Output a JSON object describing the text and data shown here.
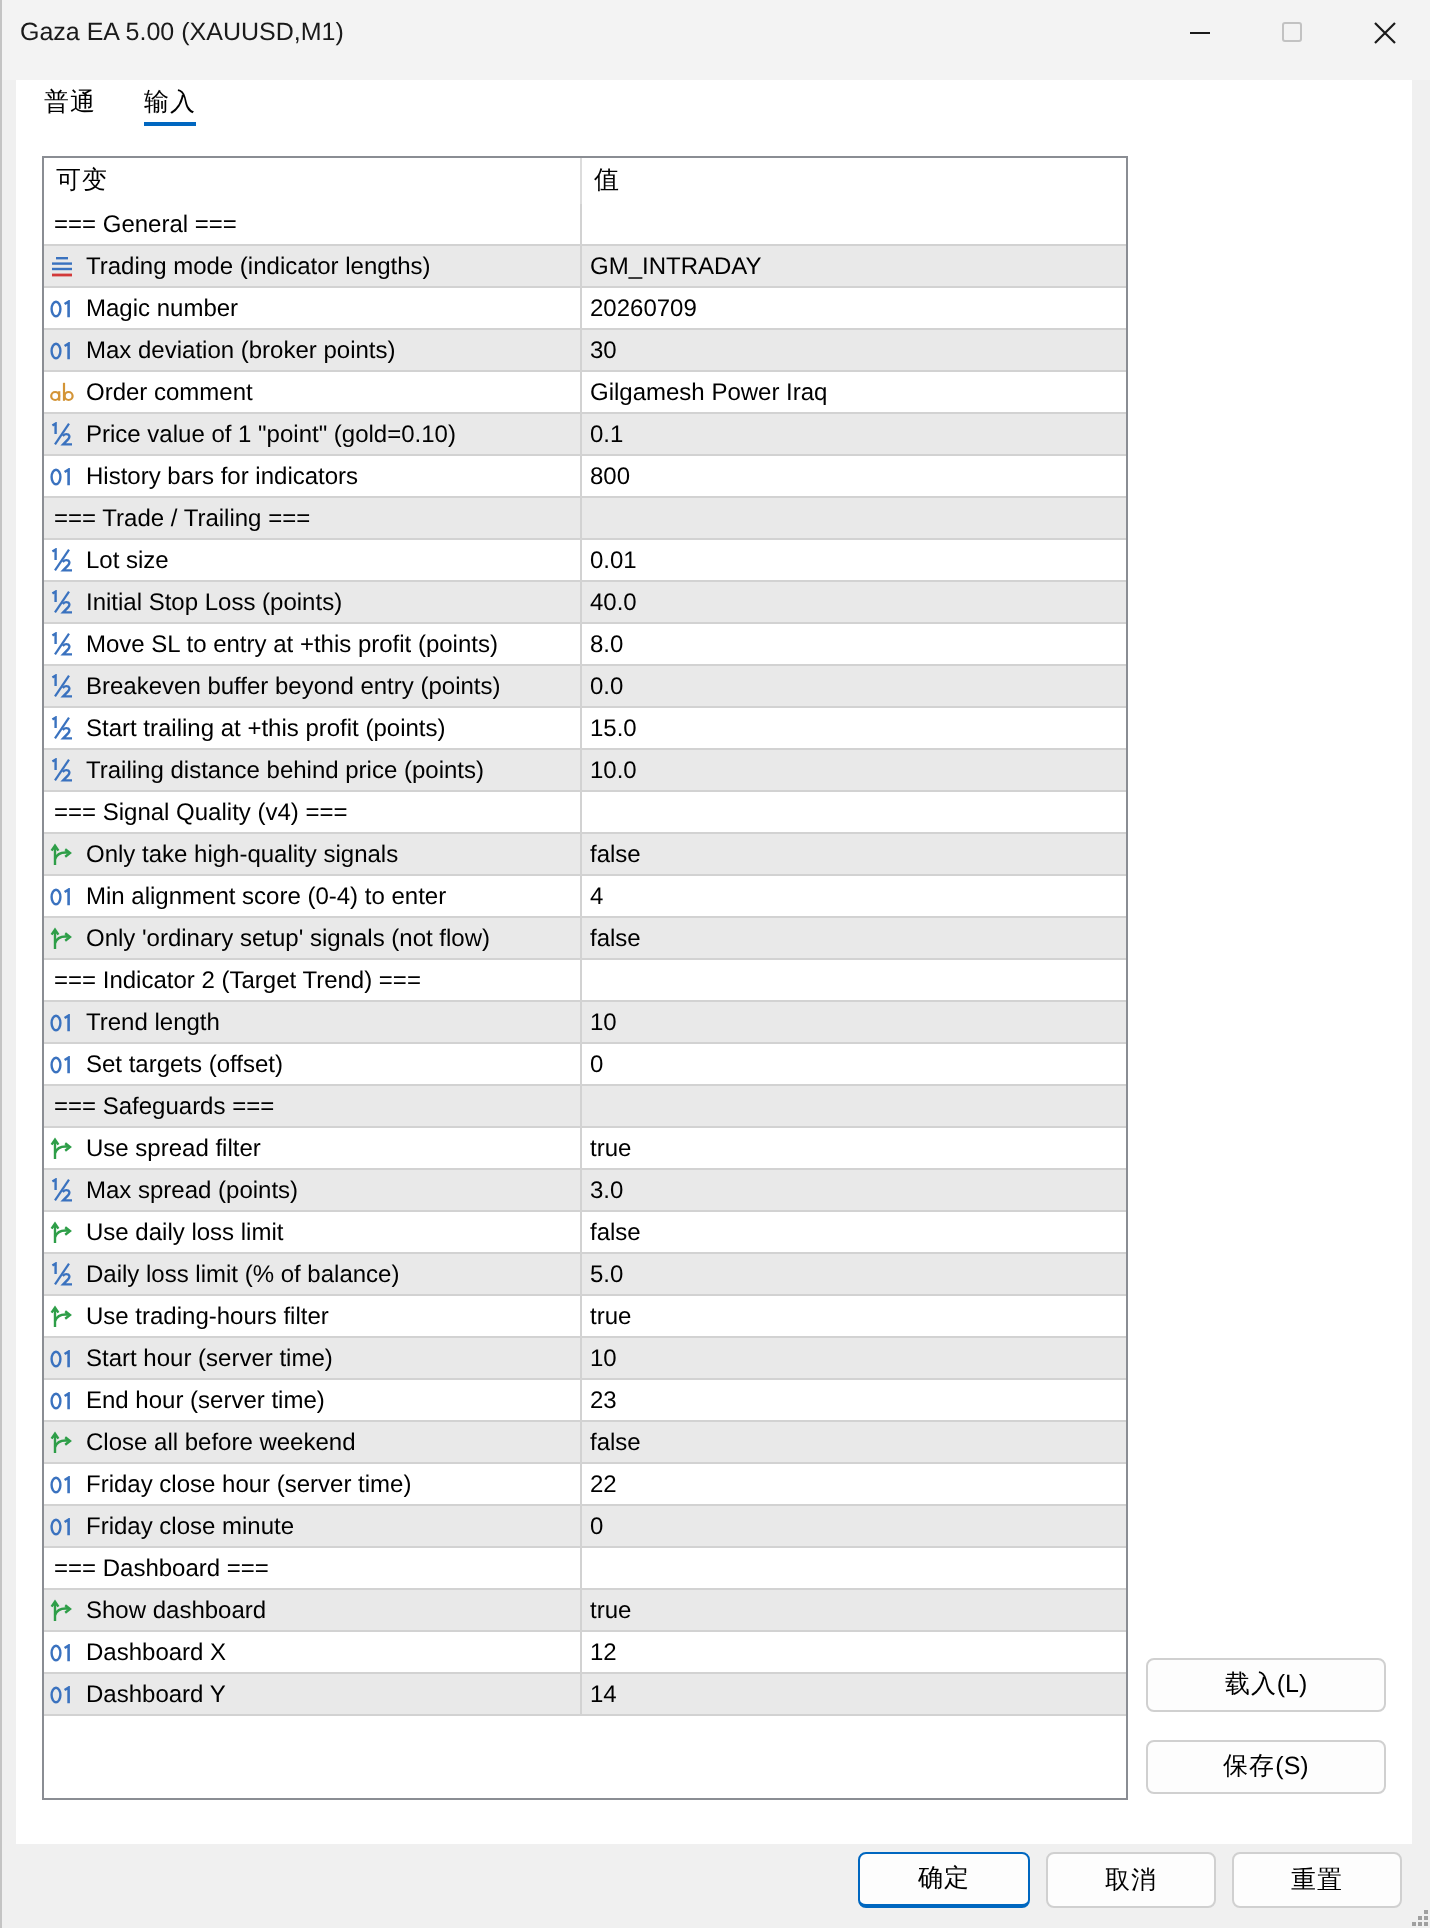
{
  "window": {
    "title": "Gaza EA 5.00 (XAUUSD,M1)",
    "controls": [
      {
        "kind": "minimize",
        "disabled": false
      },
      {
        "kind": "maximize",
        "disabled": true
      },
      {
        "kind": "close",
        "disabled": false
      }
    ]
  },
  "tabs": [
    {
      "label": "普通",
      "selected": false
    },
    {
      "label": "输入",
      "selected": true
    }
  ],
  "table": {
    "columns": [
      "可变",
      "值"
    ],
    "rows": [
      {
        "kind": "section",
        "name": "=== General ==="
      },
      {
        "kind": "enum",
        "name": "Trading mode (indicator lengths)",
        "value": "GM_INTRADAY"
      },
      {
        "kind": "int",
        "name": "Magic number",
        "value": "20260709"
      },
      {
        "kind": "int",
        "name": "Max deviation (broker points)",
        "value": "30"
      },
      {
        "kind": "string",
        "name": "Order comment",
        "value": "Gilgamesh Power Iraq"
      },
      {
        "kind": "double",
        "name": "Price value of 1 \"point\" (gold=0.10)",
        "value": "0.1"
      },
      {
        "kind": "int",
        "name": "History bars for indicators",
        "value": "800"
      },
      {
        "kind": "section",
        "name": "=== Trade / Trailing ==="
      },
      {
        "kind": "double",
        "name": "Lot size",
        "value": "0.01"
      },
      {
        "kind": "double",
        "name": "Initial Stop Loss (points)",
        "value": "40.0"
      },
      {
        "kind": "double",
        "name": "Move SL to entry at +this profit (points)",
        "value": "8.0"
      },
      {
        "kind": "double",
        "name": "Breakeven buffer beyond entry (points)",
        "value": "0.0"
      },
      {
        "kind": "double",
        "name": "Start trailing at +this profit (points)",
        "value": "15.0"
      },
      {
        "kind": "double",
        "name": "Trailing distance behind price (points)",
        "value": "10.0"
      },
      {
        "kind": "section",
        "name": "=== Signal Quality (v4) ==="
      },
      {
        "kind": "bool",
        "name": "Only take high-quality signals",
        "value": "false"
      },
      {
        "kind": "int",
        "name": "Min alignment score (0-4) to enter",
        "value": "4"
      },
      {
        "kind": "bool",
        "name": "Only 'ordinary setup' signals (not flow)",
        "value": "false"
      },
      {
        "kind": "section",
        "name": "=== Indicator 2 (Target Trend) ==="
      },
      {
        "kind": "int",
        "name": "Trend length",
        "value": "10"
      },
      {
        "kind": "int",
        "name": "Set targets (offset)",
        "value": "0"
      },
      {
        "kind": "section",
        "name": "=== Safeguards ==="
      },
      {
        "kind": "bool",
        "name": "Use spread filter",
        "value": "true"
      },
      {
        "kind": "double",
        "name": "Max spread (points)",
        "value": "3.0"
      },
      {
        "kind": "bool",
        "name": "Use daily loss limit",
        "value": "false"
      },
      {
        "kind": "double",
        "name": "Daily loss limit (% of balance)",
        "value": "5.0"
      },
      {
        "kind": "bool",
        "name": "Use trading-hours filter",
        "value": "true"
      },
      {
        "kind": "int",
        "name": "Start hour (server time)",
        "value": "10"
      },
      {
        "kind": "int",
        "name": "End hour (server time)",
        "value": "23"
      },
      {
        "kind": "bool",
        "name": "Close all before weekend",
        "value": "false"
      },
      {
        "kind": "int",
        "name": "Friday close hour (server time)",
        "value": "22"
      },
      {
        "kind": "int",
        "name": "Friday close minute",
        "value": "0"
      },
      {
        "kind": "section",
        "name": "=== Dashboard ==="
      },
      {
        "kind": "bool",
        "name": "Show dashboard",
        "value": "true"
      },
      {
        "kind": "int",
        "name": "Dashboard X",
        "value": "12"
      },
      {
        "kind": "int",
        "name": "Dashboard Y",
        "value": "14"
      }
    ]
  },
  "side_buttons": [
    "载入(L)",
    "保存(S)"
  ],
  "footer_buttons": [
    {
      "label": "确定",
      "default": true
    },
    {
      "label": "取消",
      "default": false
    },
    {
      "label": "重置",
      "default": false
    }
  ]
}
